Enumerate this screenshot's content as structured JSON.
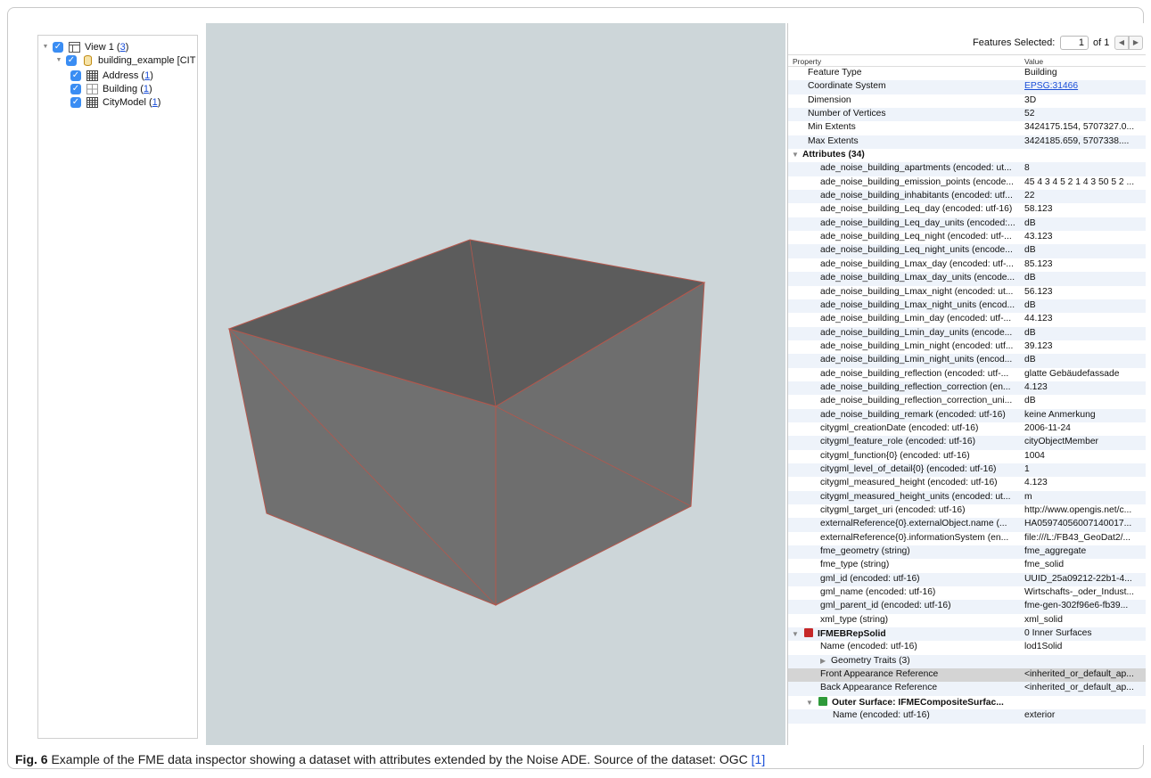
{
  "tree": {
    "view": {
      "label": "View 1",
      "count": "3"
    },
    "dataset": {
      "label": "building_example [CIT"
    },
    "layers": [
      {
        "label": "Address",
        "count": "1"
      },
      {
        "label": "Building",
        "count": "1"
      },
      {
        "label": "CityModel",
        "count": "1"
      }
    ]
  },
  "panel": {
    "features_selected_label": "Features Selected:",
    "features_selected_value": "1",
    "of_label": "of 1",
    "header": {
      "property": "Property",
      "value": "Value"
    },
    "rows": [
      {
        "p": "Feature Type",
        "v": "Building",
        "k": "top"
      },
      {
        "p": "Coordinate System",
        "v": "EPSG:31466",
        "k": "top",
        "link": true
      },
      {
        "p": "Dimension",
        "v": "3D",
        "k": "top"
      },
      {
        "p": "Number of Vertices",
        "v": "52",
        "k": "top"
      },
      {
        "p": "Min Extents",
        "v": "3424175.154, 5707327.0...",
        "k": "top"
      },
      {
        "p": "Max Extents",
        "v": "3424185.659, 5707338....",
        "k": "top"
      },
      {
        "p": "Attributes (34)",
        "v": "",
        "k": "grp"
      },
      {
        "p": "ade_noise_building_apartments (encoded: ut...",
        "v": "8",
        "k": "attr"
      },
      {
        "p": "ade_noise_building_emission_points (encode...",
        "v": "45 4 3 4 5 2 1 4 3 50 5 2 ...",
        "k": "attr"
      },
      {
        "p": "ade_noise_building_inhabitants (encoded: utf...",
        "v": "22",
        "k": "attr"
      },
      {
        "p": "ade_noise_building_Leq_day (encoded: utf-16)",
        "v": "58.123",
        "k": "attr"
      },
      {
        "p": "ade_noise_building_Leq_day_units (encoded:...",
        "v": "dB",
        "k": "attr"
      },
      {
        "p": "ade_noise_building_Leq_night (encoded: utf-...",
        "v": "43.123",
        "k": "attr"
      },
      {
        "p": "ade_noise_building_Leq_night_units (encode...",
        "v": "dB",
        "k": "attr"
      },
      {
        "p": "ade_noise_building_Lmax_day (encoded: utf-...",
        "v": "85.123",
        "k": "attr"
      },
      {
        "p": "ade_noise_building_Lmax_day_units (encode...",
        "v": "dB",
        "k": "attr"
      },
      {
        "p": "ade_noise_building_Lmax_night (encoded: ut...",
        "v": "56.123",
        "k": "attr"
      },
      {
        "p": "ade_noise_building_Lmax_night_units (encod...",
        "v": "dB",
        "k": "attr"
      },
      {
        "p": "ade_noise_building_Lmin_day (encoded: utf-...",
        "v": "44.123",
        "k": "attr"
      },
      {
        "p": "ade_noise_building_Lmin_day_units (encode...",
        "v": "dB",
        "k": "attr"
      },
      {
        "p": "ade_noise_building_Lmin_night (encoded: utf...",
        "v": "39.123",
        "k": "attr"
      },
      {
        "p": "ade_noise_building_Lmin_night_units (encod...",
        "v": "dB",
        "k": "attr"
      },
      {
        "p": "ade_noise_building_reflection (encoded: utf-...",
        "v": "glatte Gebäudefassade",
        "k": "attr"
      },
      {
        "p": "ade_noise_building_reflection_correction (en...",
        "v": "4.123",
        "k": "attr"
      },
      {
        "p": "ade_noise_building_reflection_correction_uni...",
        "v": "dB",
        "k": "attr"
      },
      {
        "p": "ade_noise_building_remark (encoded: utf-16)",
        "v": "keine Anmerkung",
        "k": "attr"
      },
      {
        "p": "citygml_creationDate (encoded: utf-16)",
        "v": "2006-11-24",
        "k": "attr"
      },
      {
        "p": "citygml_feature_role (encoded: utf-16)",
        "v": "cityObjectMember",
        "k": "attr"
      },
      {
        "p": "citygml_function{0} (encoded: utf-16)",
        "v": "1004",
        "k": "attr"
      },
      {
        "p": "citygml_level_of_detail{0} (encoded: utf-16)",
        "v": "1",
        "k": "attr"
      },
      {
        "p": "citygml_measured_height (encoded: utf-16)",
        "v": "4.123",
        "k": "attr"
      },
      {
        "p": "citygml_measured_height_units (encoded: ut...",
        "v": "m",
        "k": "attr"
      },
      {
        "p": "citygml_target_uri (encoded: utf-16)",
        "v": "http://www.opengis.net/c...",
        "k": "attr"
      },
      {
        "p": "externalReference{0}.externalObject.name (...",
        "v": "HA05974056007140017...",
        "k": "attr"
      },
      {
        "p": "externalReference{0}.informationSystem (en...",
        "v": "file:///L:/FB43_GeoDat2/...",
        "k": "attr"
      },
      {
        "p": "fme_geometry (string)",
        "v": "fme_aggregate",
        "k": "attr"
      },
      {
        "p": "fme_type (string)",
        "v": "fme_solid",
        "k": "attr"
      },
      {
        "p": "gml_id (encoded: utf-16)",
        "v": "UUID_25a09212-22b1-4...",
        "k": "attr"
      },
      {
        "p": "gml_name (encoded: utf-16)",
        "v": "Wirtschafts-_oder_Indust...",
        "k": "attr"
      },
      {
        "p": "gml_parent_id (encoded: utf-16)",
        "v": "fme-gen-302f96e6-fb39...",
        "k": "attr"
      },
      {
        "p": "xml_type (string)",
        "v": "xml_solid",
        "k": "attr"
      },
      {
        "p": "IFMEBRepSolid",
        "v": "0 Inner Surfaces",
        "k": "grp",
        "icon": "red"
      },
      {
        "p": "Name (encoded: utf-16)",
        "v": "lod1Solid",
        "k": "attr"
      },
      {
        "p": "Geometry Traits (3)",
        "v": "",
        "k": "sub"
      },
      {
        "p": "Front Appearance Reference",
        "v": "<inherited_or_default_ap...",
        "k": "attr",
        "sel": true
      },
      {
        "p": "Back Appearance Reference",
        "v": "<inherited_or_default_ap...",
        "k": "attr"
      },
      {
        "p": "Outer Surface: IFMECompositeSurfac...",
        "v": "",
        "k": "grp2",
        "icon": "green"
      },
      {
        "p": "Name (encoded: utf-16)",
        "v": "exterior",
        "k": "attr2"
      }
    ]
  },
  "caption": {
    "fig": "Fig. 6",
    "text": " Example of the FME data inspector showing a dataset with attributes extended by the Noise ADE. Source of the dataset: OGC ",
    "cite": "[1]"
  }
}
